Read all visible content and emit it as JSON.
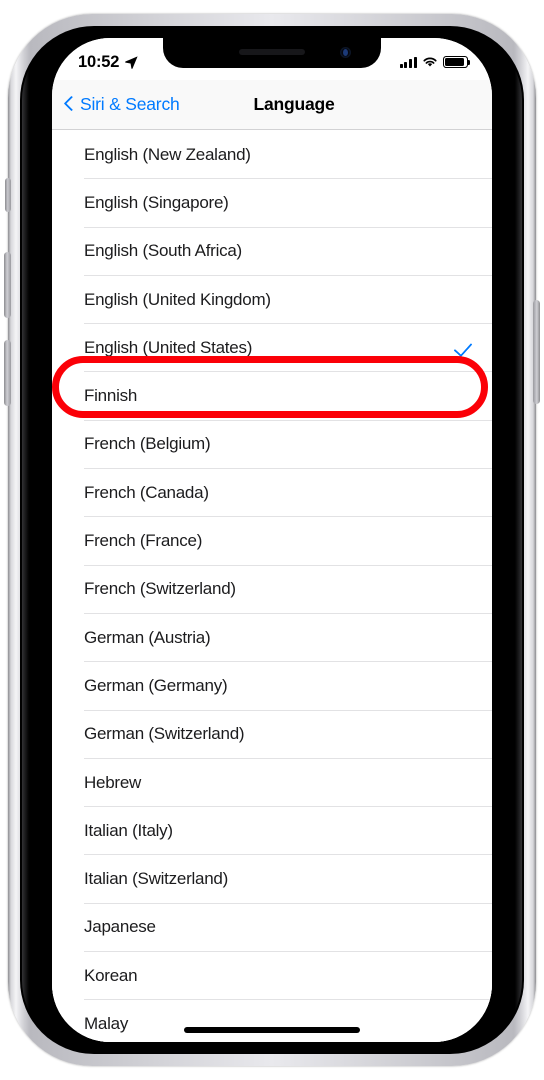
{
  "status_bar": {
    "time": "10:52",
    "location_icon": "location-arrow-icon",
    "cellular_icon": "cellular-signal-icon",
    "wifi_icon": "wifi-icon",
    "battery_icon": "battery-full-icon"
  },
  "nav_bar": {
    "back_label": "Siri & Search",
    "back_icon": "chevron-left-icon",
    "title": "Language"
  },
  "list": {
    "rows": [
      {
        "label": "English (New Zealand)",
        "selected": false
      },
      {
        "label": "English (Singapore)",
        "selected": false
      },
      {
        "label": "English (South Africa)",
        "selected": false
      },
      {
        "label": "English (United Kingdom)",
        "selected": false
      },
      {
        "label": "English (United States)",
        "selected": true
      },
      {
        "label": "Finnish",
        "selected": false
      },
      {
        "label": "French (Belgium)",
        "selected": false
      },
      {
        "label": "French (Canada)",
        "selected": false
      },
      {
        "label": "French (France)",
        "selected": false
      },
      {
        "label": "French (Switzerland)",
        "selected": false
      },
      {
        "label": "German (Austria)",
        "selected": false
      },
      {
        "label": "German (Germany)",
        "selected": false
      },
      {
        "label": "German (Switzerland)",
        "selected": false
      },
      {
        "label": "Hebrew",
        "selected": false
      },
      {
        "label": "Italian (Italy)",
        "selected": false
      },
      {
        "label": "Italian (Switzerland)",
        "selected": false
      },
      {
        "label": "Japanese",
        "selected": false
      },
      {
        "label": "Korean",
        "selected": false
      },
      {
        "label": "Malay",
        "selected": false
      }
    ],
    "checkmark_icon": "checkmark-icon"
  },
  "annotation": {
    "highlight_color": "#fb0007",
    "target_label": "English (United States)"
  },
  "colors": {
    "accent_blue": "#007aff",
    "list_background": "#efeff4",
    "row_background": "#ffffff",
    "separator": "#e2e2e4",
    "nav_background": "#f9f9f9"
  },
  "device": {
    "home_indicator": "home-indicator",
    "notch_camera": "front-camera-icon",
    "notch_speaker": "earpiece-speaker",
    "silent_switch": "silent-switch-button",
    "volume_up": "volume-up-button",
    "volume_down": "volume-down-button",
    "power": "power-button"
  }
}
